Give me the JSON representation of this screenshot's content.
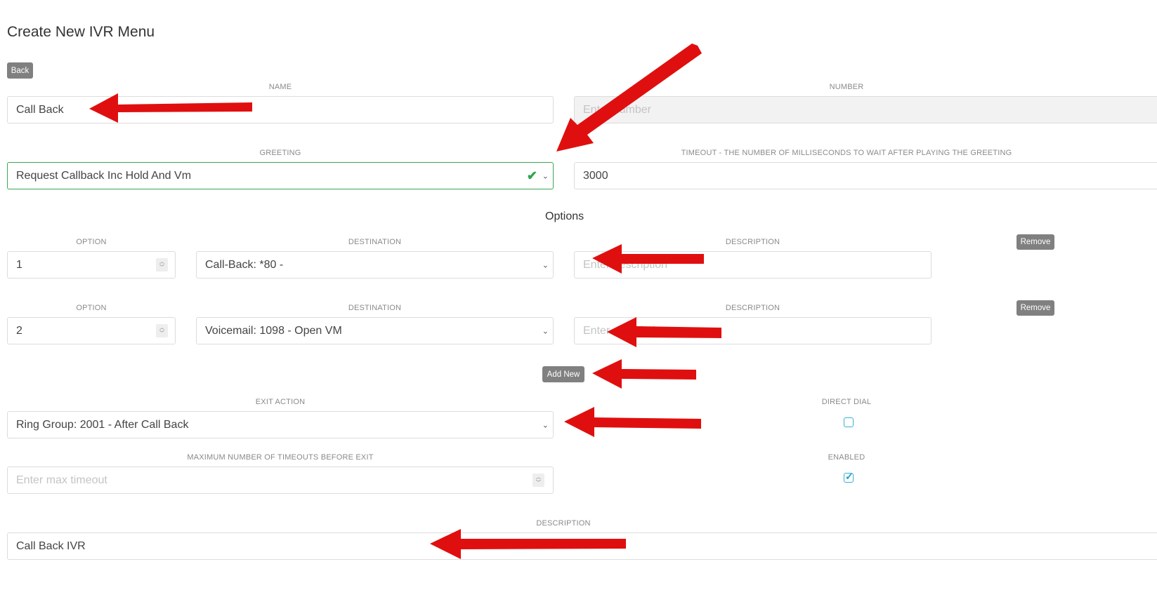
{
  "page": {
    "title": "Create New IVR Menu"
  },
  "back_button": "Back",
  "name": {
    "label": "NAME",
    "value": "Call Back"
  },
  "number": {
    "label": "NUMBER",
    "placeholder": "Enter number"
  },
  "greeting": {
    "label": "GREETING",
    "value": "Request Callback Inc Hold And Vm"
  },
  "timeout": {
    "label": "TIMEOUT - THE NUMBER OF MILLISECONDS TO WAIT AFTER PLAYING THE GREETING",
    "value": "3000"
  },
  "options_section": {
    "title": "Options"
  },
  "options": [
    {
      "option_label": "OPTION",
      "option_value": "1",
      "destination_label": "DESTINATION",
      "destination_value": "Call-Back: *80 -",
      "description_label": "DESCRIPTION",
      "description_placeholder": "Enter description",
      "remove_label": "Remove"
    },
    {
      "option_label": "OPTION",
      "option_value": "2",
      "destination_label": "DESTINATION",
      "destination_value": "Voicemail: 1098 - Open VM",
      "description_label": "DESCRIPTION",
      "description_placeholder": "Enter description",
      "remove_label": "Remove"
    }
  ],
  "add_new_button": "Add New",
  "exit_action": {
    "label": "EXIT ACTION",
    "value": "Ring Group: 2001 - After Call Back"
  },
  "direct_dial": {
    "label": "DIRECT DIAL",
    "checked": false
  },
  "max_timeouts": {
    "label": "MAXIMUM NUMBER OF TIMEOUTS BEFORE EXIT",
    "placeholder": "Enter max timeout"
  },
  "enabled": {
    "label": "ENABLED",
    "checked": true
  },
  "description": {
    "label": "DESCRIPTION",
    "value": "Call Back IVR"
  },
  "colors": {
    "annotation_arrow": "#e00f0f",
    "valid_border": "#3aa655",
    "checkbox": "#3ab0d6",
    "button": "#808080"
  },
  "icons": {
    "select_caret": "chevron-down-icon",
    "valid": "checkmark-icon",
    "spinner": "spinner-icon",
    "annotation": "arrow-icon"
  }
}
